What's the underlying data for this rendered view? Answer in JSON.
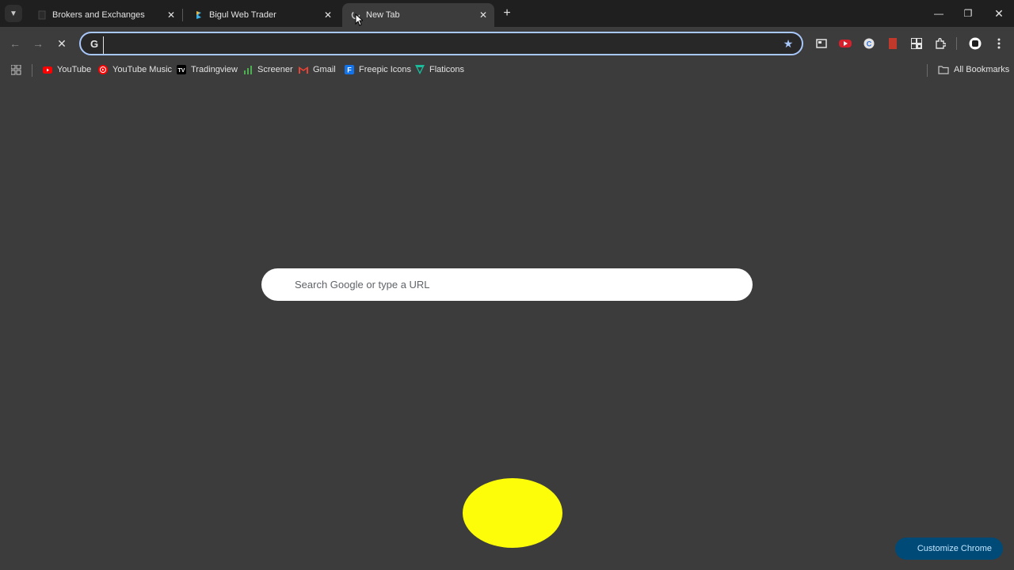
{
  "tabs": [
    {
      "title": "Brokers and Exchanges",
      "favicon": "page-icon"
    },
    {
      "title": "Bigul Web Trader",
      "favicon": "bigul-icon"
    },
    {
      "title": "New Tab",
      "favicon": "loading-icon"
    }
  ],
  "toolbar": {
    "omnibox_value": "",
    "extensions": [
      "tab-search-icon",
      "video-extension-icon",
      "grammar-extension-icon",
      "bookmark-extension-icon",
      "qr-extension-icon",
      "puzzle-icon",
      "profile-icon",
      "kebab-menu-icon"
    ]
  },
  "bookmarks": {
    "items": [
      {
        "label": "YouTube",
        "icon": "youtube-icon"
      },
      {
        "label": "YouTube Music",
        "icon": "youtube-music-icon"
      },
      {
        "label": "Tradingview",
        "icon": "tradingview-icon"
      },
      {
        "label": "Screener",
        "icon": "screener-icon"
      },
      {
        "label": "Gmail",
        "icon": "gmail-icon"
      },
      {
        "label": "Freepic Icons",
        "icon": "freepik-icon"
      },
      {
        "label": "Flaticons",
        "icon": "flaticon-icon"
      }
    ],
    "all_bookmarks": "All Bookmarks"
  },
  "ntp": {
    "search_placeholder": "Search Google or type a URL",
    "customize_label": "Customize Chrome"
  },
  "colors": {
    "background": "#3c3c3c",
    "tabstrip": "#1f1f1f",
    "omnibox_border": "#a8c7fa",
    "blob": "#fdfd09",
    "customize_bg": "#004a77"
  }
}
